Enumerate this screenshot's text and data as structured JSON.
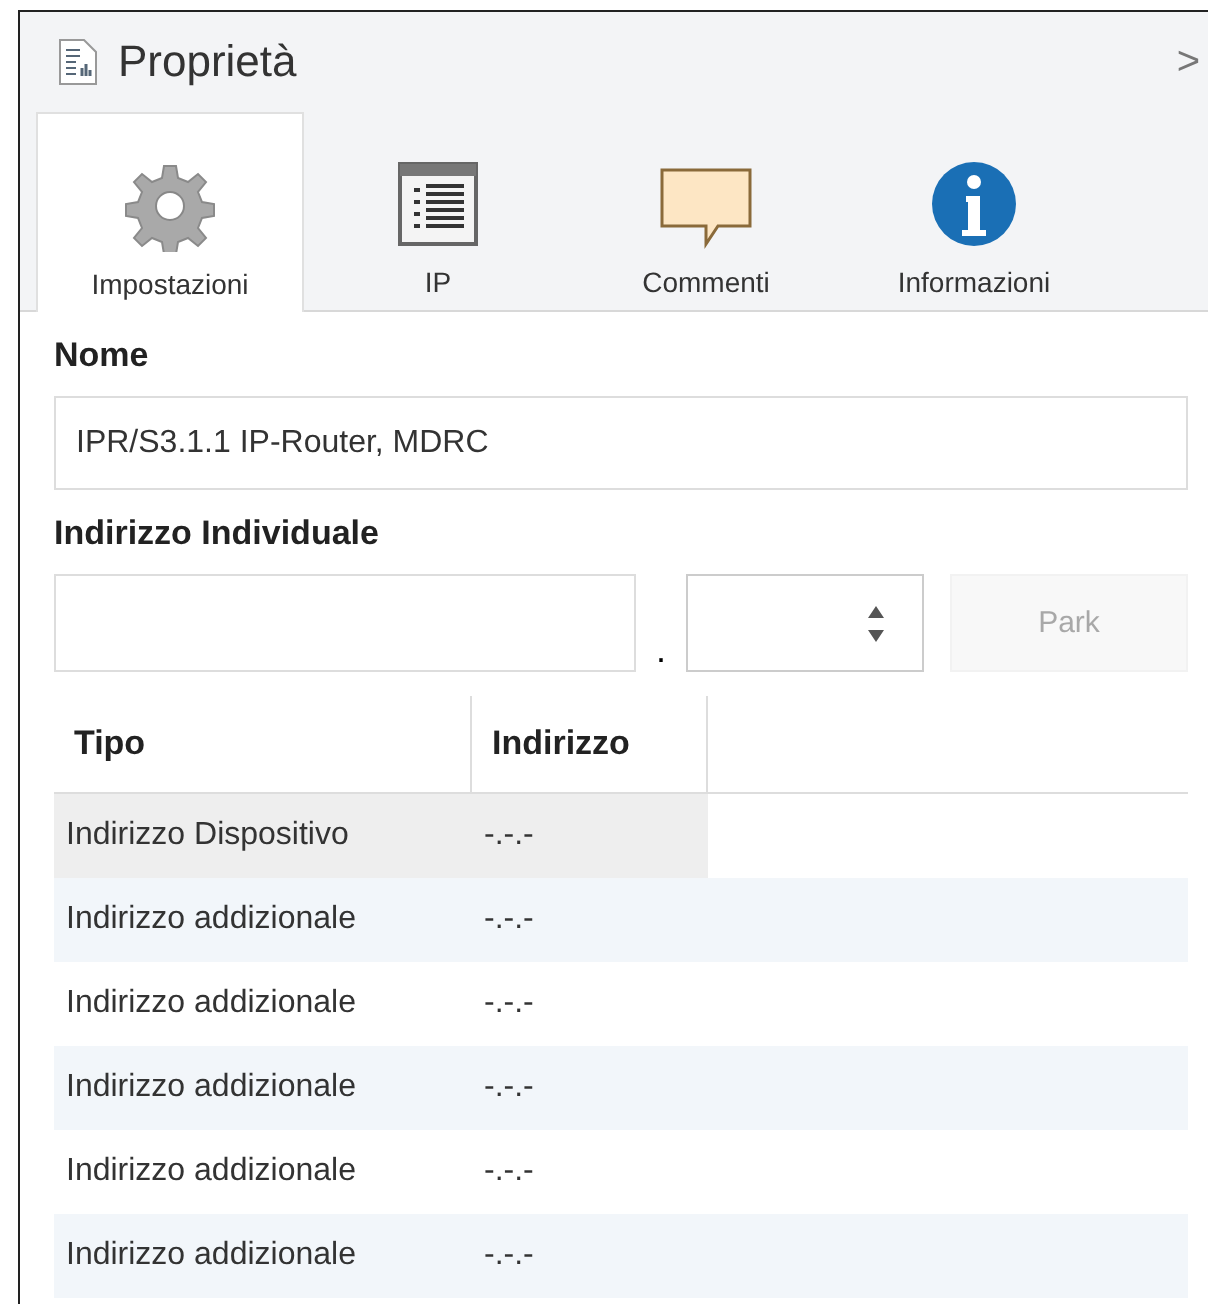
{
  "panel": {
    "title": "Proprietà",
    "collapse": ">"
  },
  "tabs": [
    {
      "label": "Impostazioni",
      "kind": "gear",
      "selected": true
    },
    {
      "label": "IP",
      "kind": "list",
      "selected": false
    },
    {
      "label": "Commenti",
      "kind": "comment",
      "selected": false
    },
    {
      "label": "Informazioni",
      "kind": "info",
      "selected": false
    }
  ],
  "name_field": {
    "label": "Nome",
    "value": "IPR/S3.1.1 IP-Router, MDRC"
  },
  "individual_address": {
    "label": "Indirizzo Individuale",
    "separator": ".",
    "park_button": {
      "label": "Park",
      "disabled": true
    }
  },
  "table": {
    "columns": [
      "Tipo",
      "Indirizzo"
    ],
    "rows": [
      {
        "tipo": "Indirizzo Dispositivo",
        "indirizzo": "-.-.-",
        "selected": true
      },
      {
        "tipo": "Indirizzo addizionale",
        "indirizzo": "-.-.-",
        "selected": false
      },
      {
        "tipo": "Indirizzo addizionale",
        "indirizzo": "-.-.-",
        "selected": false
      },
      {
        "tipo": "Indirizzo addizionale",
        "indirizzo": "-.-.-",
        "selected": false
      },
      {
        "tipo": "Indirizzo addizionale",
        "indirizzo": "-.-.-",
        "selected": false
      },
      {
        "tipo": "Indirizzo addizionale",
        "indirizzo": "-.-.-",
        "selected": false
      }
    ]
  }
}
